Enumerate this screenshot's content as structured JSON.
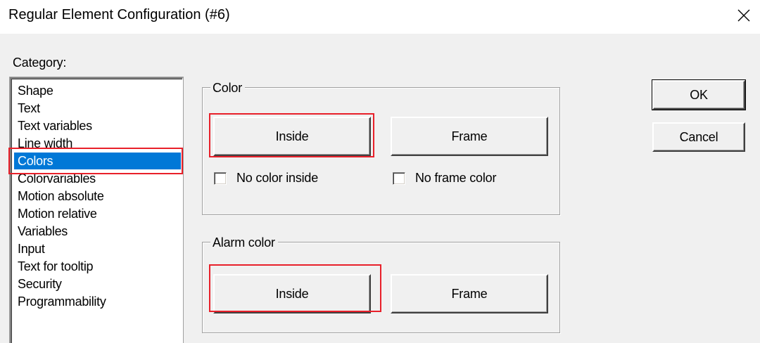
{
  "window": {
    "title": "Regular Element Configuration (#6)",
    "close_icon": "close-icon"
  },
  "category": {
    "label": "Category:",
    "items": [
      {
        "label": "Shape",
        "selected": false
      },
      {
        "label": "Text",
        "selected": false
      },
      {
        "label": "Text variables",
        "selected": false
      },
      {
        "label": "Line width",
        "selected": false
      },
      {
        "label": "Colors",
        "selected": true
      },
      {
        "label": "Colorvariables",
        "selected": false
      },
      {
        "label": "Motion absolute",
        "selected": false
      },
      {
        "label": "Motion relative",
        "selected": false
      },
      {
        "label": "Variables",
        "selected": false
      },
      {
        "label": "Input",
        "selected": false
      },
      {
        "label": "Text for tooltip",
        "selected": false
      },
      {
        "label": "Security",
        "selected": false
      },
      {
        "label": "Programmability",
        "selected": false
      }
    ]
  },
  "color_group": {
    "legend": "Color",
    "inside_label": "Inside",
    "frame_label": "Frame",
    "no_color_inside_label": "No color inside",
    "no_color_inside_checked": false,
    "no_frame_color_label": "No frame color",
    "no_frame_color_checked": false
  },
  "alarm_group": {
    "legend": "Alarm color",
    "inside_label": "Inside",
    "frame_label": "Frame"
  },
  "actions": {
    "ok_label": "OK",
    "cancel_label": "Cancel"
  },
  "colors": {
    "selection": "#0078d7",
    "highlight_box": "#e8202a",
    "dialog_bg": "#f0f0f0"
  }
}
